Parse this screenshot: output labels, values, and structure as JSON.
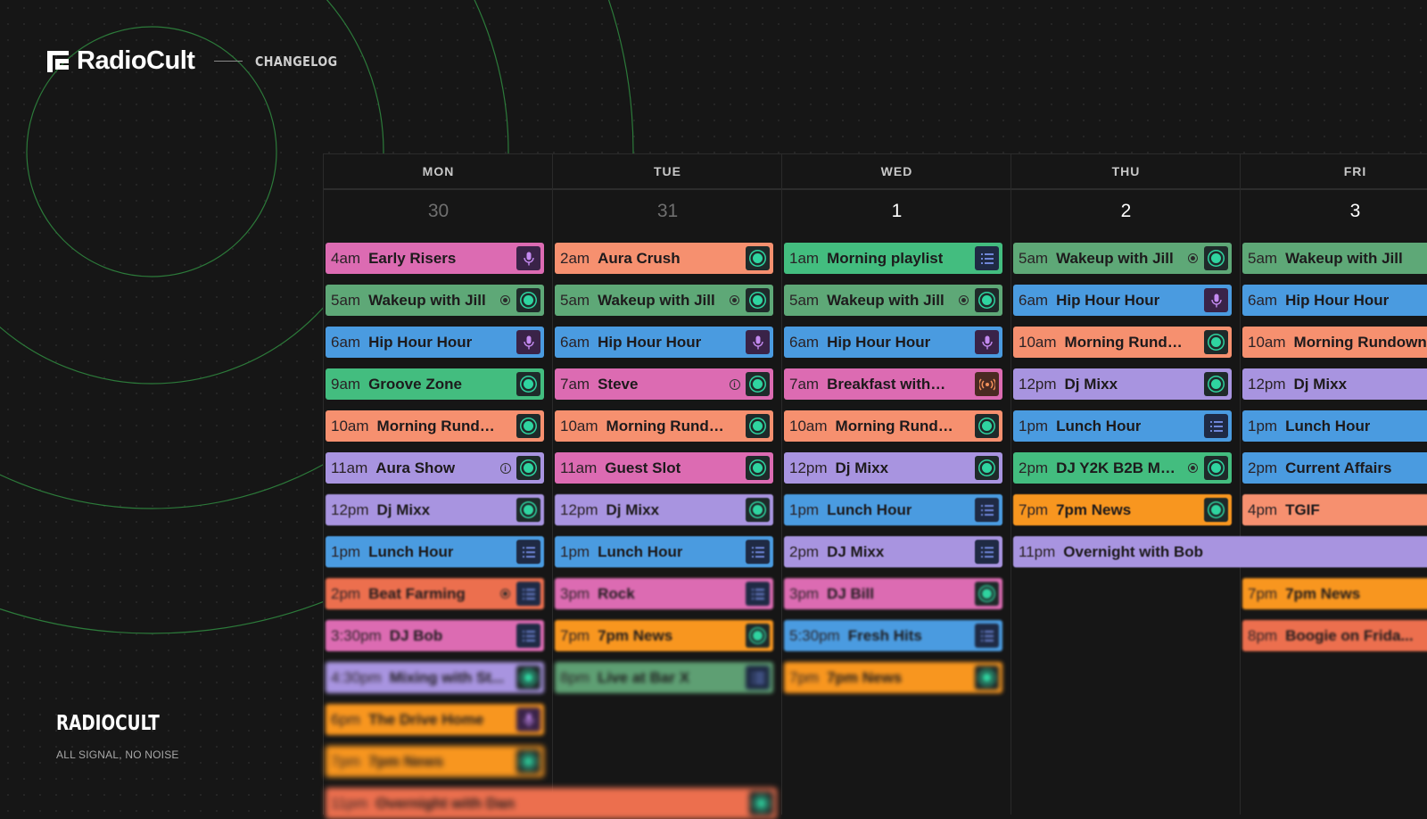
{
  "brand": {
    "name": "RadioCult",
    "link": "CHANGELOG"
  },
  "footer": {
    "title": "RADIOCULT",
    "tagline": "ALL SIGNAL, NO NOISE"
  },
  "calendar": {
    "days": [
      {
        "name": "MON",
        "date": "30",
        "past": true
      },
      {
        "name": "TUE",
        "date": "31",
        "past": true
      },
      {
        "name": "WED",
        "date": "1",
        "past": false
      },
      {
        "name": "THU",
        "date": "2",
        "past": false
      },
      {
        "name": "FRI",
        "date": "3",
        "past": false
      }
    ],
    "events": [
      {
        "day": 0,
        "row": 0,
        "time": "4am",
        "name": "Early Risers",
        "color": "#dc6bb2",
        "icon": "mic-icon"
      },
      {
        "day": 0,
        "row": 1,
        "time": "5am",
        "name": "Wakeup with Jill",
        "color": "#5ea877",
        "icon": "radio-icon",
        "extra": "record-icon"
      },
      {
        "day": 0,
        "row": 2,
        "time": "6am",
        "name": "Hip Hour Hour",
        "color": "#4a9be0",
        "icon": "mic-icon"
      },
      {
        "day": 0,
        "row": 3,
        "time": "9am",
        "name": "Groove Zone",
        "color": "#43bd7f",
        "icon": "radio-icon"
      },
      {
        "day": 0,
        "row": 4,
        "time": "10am",
        "name": "Morning Rundown",
        "color": "#f6906f",
        "icon": "radio-icon"
      },
      {
        "day": 0,
        "row": 5,
        "time": "11am",
        "name": "Aura Show",
        "color": "#a894e0",
        "icon": "radio-icon",
        "extra": "info-icon"
      },
      {
        "day": 0,
        "row": 6,
        "time": "12pm",
        "name": "Dj Mixx",
        "color": "#a894e0",
        "icon": "radio-icon"
      },
      {
        "day": 0,
        "row": 7,
        "time": "1pm",
        "name": "Lunch Hour",
        "color": "#4a9be0",
        "icon": "list-icon"
      },
      {
        "day": 0,
        "row": 8,
        "time": "2pm",
        "name": "Beat Farming",
        "color": "#ec6f4e",
        "icon": "list-icon",
        "extra": "record-icon"
      },
      {
        "day": 0,
        "row": 9,
        "time": "3:30pm",
        "name": "DJ Bob",
        "color": "#dc6bb2",
        "icon": "list-icon"
      },
      {
        "day": 0,
        "row": 10,
        "time": "4:30pm",
        "name": "Mixing with St...",
        "color": "#a894e0",
        "icon": "radio-icon"
      },
      {
        "day": 0,
        "row": 11,
        "time": "6pm",
        "name": "The Drive Home",
        "color": "#f8961f",
        "icon": "mic-icon"
      },
      {
        "day": 0,
        "row": 12,
        "time": "7pm",
        "name": "7pm News",
        "color": "#f8961f",
        "icon": "radio-icon"
      },
      {
        "day": 0,
        "row": 13,
        "time": "11pm",
        "name": "Overnight with Dan",
        "color": "#ec6f4e",
        "icon": "radio-icon",
        "span": 2
      },
      {
        "day": 1,
        "row": 0,
        "time": "2am",
        "name": "Aura Crush",
        "color": "#f6906f",
        "icon": "radio-icon"
      },
      {
        "day": 1,
        "row": 1,
        "time": "5am",
        "name": "Wakeup with Jill",
        "color": "#5ea877",
        "icon": "radio-icon",
        "extra": "record-icon"
      },
      {
        "day": 1,
        "row": 2,
        "time": "6am",
        "name": "Hip Hour Hour",
        "color": "#4a9be0",
        "icon": "mic-icon"
      },
      {
        "day": 1,
        "row": 3,
        "time": "7am",
        "name": "Steve",
        "color": "#dc6bb2",
        "icon": "radio-icon",
        "extra": "info-icon"
      },
      {
        "day": 1,
        "row": 4,
        "time": "10am",
        "name": "Morning Rundown",
        "color": "#f6906f",
        "icon": "radio-icon"
      },
      {
        "day": 1,
        "row": 5,
        "time": "11am",
        "name": "Guest Slot",
        "color": "#dc6bb2",
        "icon": "radio-icon"
      },
      {
        "day": 1,
        "row": 6,
        "time": "12pm",
        "name": "Dj Mixx",
        "color": "#a894e0",
        "icon": "radio-icon"
      },
      {
        "day": 1,
        "row": 7,
        "time": "1pm",
        "name": "Lunch Hour",
        "color": "#4a9be0",
        "icon": "list-icon"
      },
      {
        "day": 1,
        "row": 8,
        "time": "3pm",
        "name": "Rock",
        "color": "#dc6bb2",
        "icon": "list-icon"
      },
      {
        "day": 1,
        "row": 9,
        "time": "7pm",
        "name": "7pm News",
        "color": "#f8961f",
        "icon": "radio-icon"
      },
      {
        "day": 1,
        "row": 10,
        "time": "8pm",
        "name": "Live at Bar X",
        "color": "#5e9f73",
        "icon": "list-icon"
      },
      {
        "day": 2,
        "row": 0,
        "time": "1am",
        "name": "Morning playlist",
        "color": "#43bd7f",
        "icon": "list-icon"
      },
      {
        "day": 2,
        "row": 1,
        "time": "5am",
        "name": "Wakeup with Jill",
        "color": "#5ea877",
        "icon": "radio-icon",
        "extra": "record-icon"
      },
      {
        "day": 2,
        "row": 2,
        "time": "6am",
        "name": "Hip Hour Hour",
        "color": "#4a9be0",
        "icon": "mic-icon"
      },
      {
        "day": 2,
        "row": 3,
        "time": "7am",
        "name": "Breakfast with Be...",
        "color": "#dc6bb2",
        "icon": "broadcast-icon"
      },
      {
        "day": 2,
        "row": 4,
        "time": "10am",
        "name": "Morning Rundown",
        "color": "#f6906f",
        "icon": "radio-icon"
      },
      {
        "day": 2,
        "row": 5,
        "time": "12pm",
        "name": "Dj Mixx",
        "color": "#a894e0",
        "icon": "radio-icon"
      },
      {
        "day": 2,
        "row": 6,
        "time": "1pm",
        "name": "Lunch Hour",
        "color": "#4a9be0",
        "icon": "list-icon"
      },
      {
        "day": 2,
        "row": 7,
        "time": "2pm",
        "name": "DJ Mixx",
        "color": "#a894e0",
        "icon": "list-icon"
      },
      {
        "day": 2,
        "row": 8,
        "time": "3pm",
        "name": "DJ Bill",
        "color": "#dc6bb2",
        "icon": "radio-icon"
      },
      {
        "day": 2,
        "row": 9,
        "time": "5:30pm",
        "name": "Fresh Hits",
        "color": "#4a9be0",
        "icon": "list-icon"
      },
      {
        "day": 2,
        "row": 10,
        "time": "7pm",
        "name": "7pm News",
        "color": "#f8961f",
        "icon": "radio-icon"
      },
      {
        "day": 3,
        "row": 0,
        "time": "5am",
        "name": "Wakeup with Jill",
        "color": "#5ea877",
        "icon": "radio-icon",
        "extra": "record-icon"
      },
      {
        "day": 3,
        "row": 1,
        "time": "6am",
        "name": "Hip Hour Hour",
        "color": "#4a9be0",
        "icon": "mic-icon"
      },
      {
        "day": 3,
        "row": 2,
        "time": "10am",
        "name": "Morning Rundown",
        "color": "#f6906f",
        "icon": "radio-icon"
      },
      {
        "day": 3,
        "row": 3,
        "time": "12pm",
        "name": "Dj Mixx",
        "color": "#a894e0",
        "icon": "radio-icon"
      },
      {
        "day": 3,
        "row": 4,
        "time": "1pm",
        "name": "Lunch Hour",
        "color": "#4a9be0",
        "icon": "list-icon"
      },
      {
        "day": 3,
        "row": 5,
        "time": "2pm",
        "name": "DJ Y2K B2B Mix...",
        "color": "#43bd7f",
        "icon": "radio-icon",
        "extra": "record-icon"
      },
      {
        "day": 3,
        "row": 6,
        "time": "7pm",
        "name": "7pm News",
        "color": "#f8961f",
        "icon": "radio-icon"
      },
      {
        "day": 3,
        "row": 7,
        "time": "11pm",
        "name": "Overnight with Bob",
        "color": "#a894e0",
        "icon": "",
        "span": 2
      },
      {
        "day": 4,
        "row": 0,
        "time": "5am",
        "name": "Wakeup with Jill",
        "color": "#5ea877",
        "icon": "",
        "extra": "record-icon"
      },
      {
        "day": 4,
        "row": 1,
        "time": "6am",
        "name": "Hip Hour Hour",
        "color": "#4a9be0",
        "icon": ""
      },
      {
        "day": 4,
        "row": 2,
        "time": "10am",
        "name": "Morning Rundown",
        "color": "#f6906f",
        "icon": ""
      },
      {
        "day": 4,
        "row": 3,
        "time": "12pm",
        "name": "Dj Mixx",
        "color": "#a894e0",
        "icon": ""
      },
      {
        "day": 4,
        "row": 4,
        "time": "1pm",
        "name": "Lunch Hour",
        "color": "#4a9be0",
        "icon": ""
      },
      {
        "day": 4,
        "row": 5,
        "time": "2pm",
        "name": "Current Affairs",
        "color": "#4a9be0",
        "icon": ""
      },
      {
        "day": 4,
        "row": 6,
        "time": "4pm",
        "name": "TGIF",
        "color": "#f6906f",
        "icon": ""
      },
      {
        "day": 4,
        "row": 8,
        "time": "7pm",
        "name": "7pm News",
        "color": "#f8961f",
        "icon": ""
      },
      {
        "day": 4,
        "row": 9,
        "time": "8pm",
        "name": "Boogie on Frida...",
        "color": "#ec6f4e",
        "icon": "",
        "extra": "record-icon"
      }
    ]
  }
}
